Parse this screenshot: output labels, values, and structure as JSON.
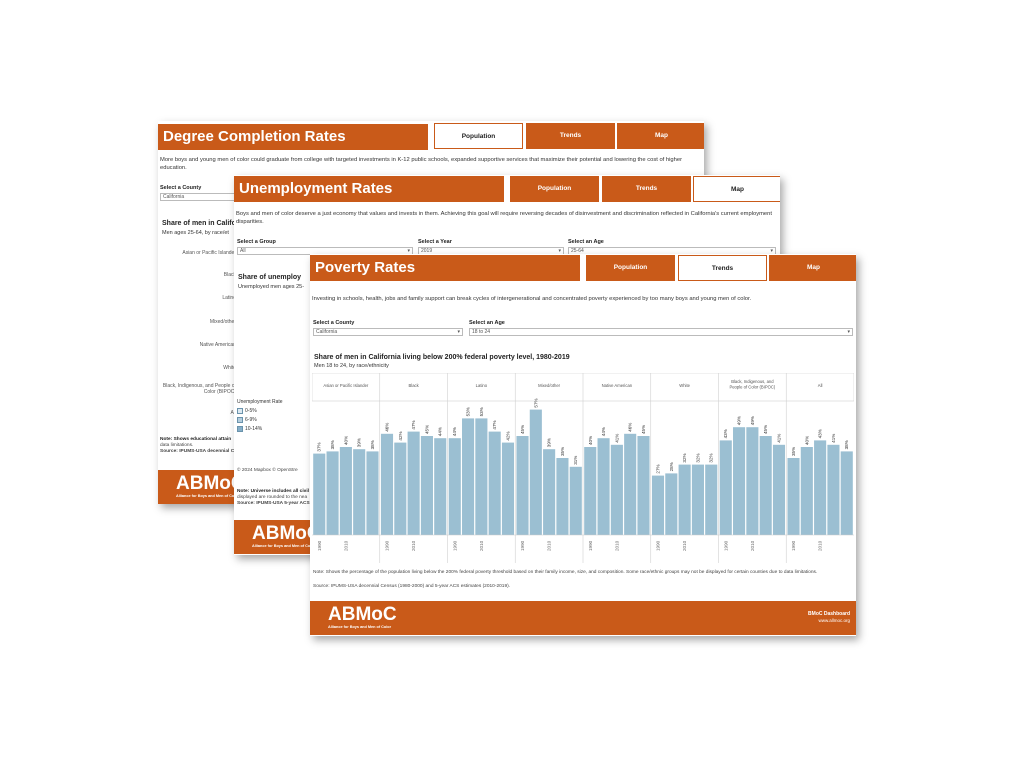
{
  "degree": {
    "title": "Degree Completion Rates",
    "tabs": [
      "Population",
      "Trends",
      "Map"
    ],
    "intro": "More boys and young men of color could graduate from college with targeted investments in K-12 public schools, expanded supportive services that maximize their potential and lowering the cost of higher education.",
    "county_label": "Select a County",
    "county_value": "California",
    "chart_title": "Share of men in Califo",
    "chart_sub": "Men ages 25-64, by race/et",
    "rows": [
      "Asian or Pacific Islander",
      "Black",
      "Latino",
      "Mixed/other",
      "Native American",
      "White",
      "Black, Indigenous, and People of Color (BIPOC)",
      "All"
    ],
    "note1": "Note: Shows educational attain",
    "note2": "data limitations.",
    "note3": "Source: IPUMS-USA decennial Ce",
    "logo": "ABMoC",
    "logo_sub": "Alliance for Boys and Men of Color"
  },
  "unemp": {
    "title": "Unemployment Rates",
    "tabs": [
      "Population",
      "Trends",
      "Map"
    ],
    "intro": "Boys and men of color deserve a just economy that values and invests in them.  Achieving this goal will require reversing decades of disinvestment and discrimination reflected in California's current employment disparities.",
    "group_label": "Select a Group",
    "group_value": "All",
    "year_label": "Select a Year",
    "year_value": "2019",
    "age_label": "Select an Age",
    "age_value": "25-64",
    "chart_title": "Share of unemploy",
    "chart_sub": "Unemployed men ages 25-",
    "legend_title": "Unemployment Rate",
    "legend": [
      "0-5%",
      "6-9%",
      "10-14%"
    ],
    "legend_colors": [
      "#dde9f1",
      "#b4cddd",
      "#85aec8"
    ],
    "credit": "© 2024 Mapbox  © OpenStre",
    "note1": "Note: Universe includes all civil",
    "note2": "displayed are rounded to the nea",
    "note3": "Source: IPUMS-USA 5-year ACS e",
    "logo": "ABMoC",
    "logo_sub": "Alliance for Boys and Men of Color"
  },
  "poverty": {
    "title": "Poverty Rates",
    "tabs": [
      "Population",
      "Trends",
      "Map"
    ],
    "intro": "Investing in schools, health, jobs and family support can break cycles of intergenerational and concentrated poverty experienced by too many boys and young men of color.",
    "county_label": "Select a County",
    "county_value": "California",
    "age_label": "Select an Age",
    "age_value": "18 to 24",
    "chart_title": "Share of men in California  living below 200% federal poverty level, 1980-2019",
    "chart_sub": "Men 18 to 24, by race/ethnicity",
    "note": "Note: Shows the percentage of the population living below the 200% federal poverty threshold based on their family income, size, and composition. Some race/ethnic groups may not be displayed for certain counties due to data limitations.",
    "source": "Source: IPUMS-USA decennial Census (1980-2000) and 5-year ACS estimates (2010-2019).",
    "logo": "ABMoC",
    "logo_sub": "Alliance for Boys and Men of Color",
    "dash_label": "BMoC Dashboard",
    "dash_url": "www.allmoc.org"
  },
  "chart_data": {
    "type": "bar",
    "title": "Share of men in California  living below 200% federal poverty level, 1980-2019",
    "subtitle": "Men 18 to 24, by race/ethnicity",
    "ylim": [
      0,
      60
    ],
    "bar_color": "#9bbfd2",
    "x_tick_labels": [
      "1990",
      "2010"
    ],
    "groups": [
      {
        "name": "Asian or Pacific Islander",
        "labels": [
          "37%",
          "38%",
          "40%",
          "39%",
          "38%"
        ],
        "values": [
          37,
          38,
          40,
          39,
          38
        ]
      },
      {
        "name": "Black",
        "labels": [
          "46%",
          "42%",
          "47%",
          "45%",
          "44%"
        ],
        "values": [
          46,
          42,
          47,
          45,
          44
        ]
      },
      {
        "name": "Latino",
        "labels": [
          "44%",
          "53%",
          "53%",
          "47%",
          "42%"
        ],
        "values": [
          44,
          53,
          53,
          47,
          42
        ]
      },
      {
        "name": "Mixed/other",
        "labels": [
          "45%",
          "57%",
          "39%",
          "35%",
          "31%"
        ],
        "values": [
          45,
          57,
          39,
          35,
          31
        ]
      },
      {
        "name": "Native American",
        "labels": [
          "40%",
          "44%",
          "41%",
          "46%",
          "45%"
        ],
        "values": [
          40,
          44,
          41,
          46,
          45
        ]
      },
      {
        "name": "White",
        "labels": [
          "27%",
          "28%",
          "32%",
          "32%",
          "32%"
        ],
        "values": [
          27,
          28,
          32,
          32,
          32
        ]
      },
      {
        "name": "Black, Indigenous, and People of Color (BIPOC)",
        "labels": [
          "43%",
          "49%",
          "49%",
          "45%",
          "41%"
        ],
        "values": [
          43,
          49,
          49,
          45,
          41
        ]
      },
      {
        "name": "All",
        "labels": [
          "35%",
          "40%",
          "43%",
          "41%",
          "38%"
        ],
        "values": [
          35,
          40,
          43,
          41,
          38
        ]
      }
    ]
  }
}
